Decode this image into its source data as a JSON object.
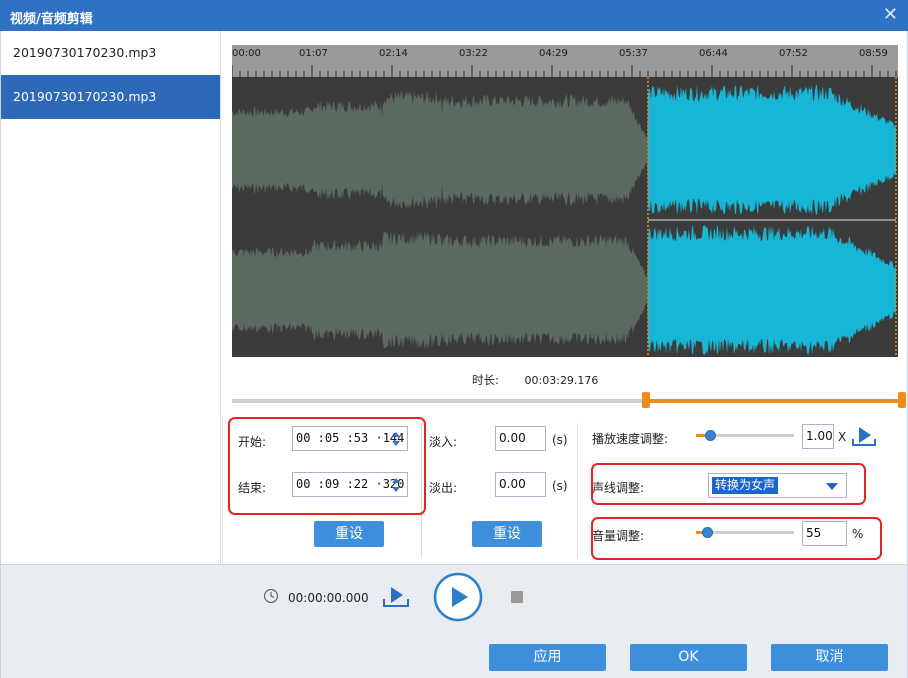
{
  "window": {
    "title": "视频/音频剪辑"
  },
  "files": [
    {
      "name": "20190730170230.mp3",
      "selected": false
    },
    {
      "name": "20190730170230.mp3",
      "selected": true
    }
  ],
  "ruler": {
    "labels": [
      "00:00",
      "01:07",
      "02:14",
      "03:22",
      "04:29",
      "05:37",
      "06:44",
      "07:52",
      "08:59"
    ]
  },
  "info": {
    "duration_label": "时长:",
    "duration_value": "00:03:29.176"
  },
  "trim": {
    "start_label": "开始:",
    "start_value": "00 :05 :53 ·144",
    "end_label": "结束:",
    "end_value": "00 :09 :22 ·320",
    "reset_label": "重设"
  },
  "fade": {
    "fade_in_label": "淡入:",
    "fade_in_value": "0.00",
    "fade_out_label": "淡出:",
    "fade_out_value": "0.00",
    "unit": "(s)",
    "reset_label": "重设"
  },
  "audio": {
    "speed_label": "播放速度调整:",
    "speed_value": "1.00",
    "speed_unit": "X",
    "voice_label": "声线调整:",
    "voice_value": "转换为女声",
    "volume_label": "音量调整:",
    "volume_value": "55",
    "volume_unit": "%"
  },
  "playback": {
    "timecode": "00:00:00.000"
  },
  "footer": {
    "apply_label": "应用",
    "ok_label": "OK",
    "cancel_label": "取消"
  },
  "colors": {
    "accent": "#2f72c4",
    "selection": "#f28a1a",
    "wave_inactive": "#5a6a5e",
    "wave_active": "#17b6d6",
    "highlight_box": "#e52525"
  }
}
